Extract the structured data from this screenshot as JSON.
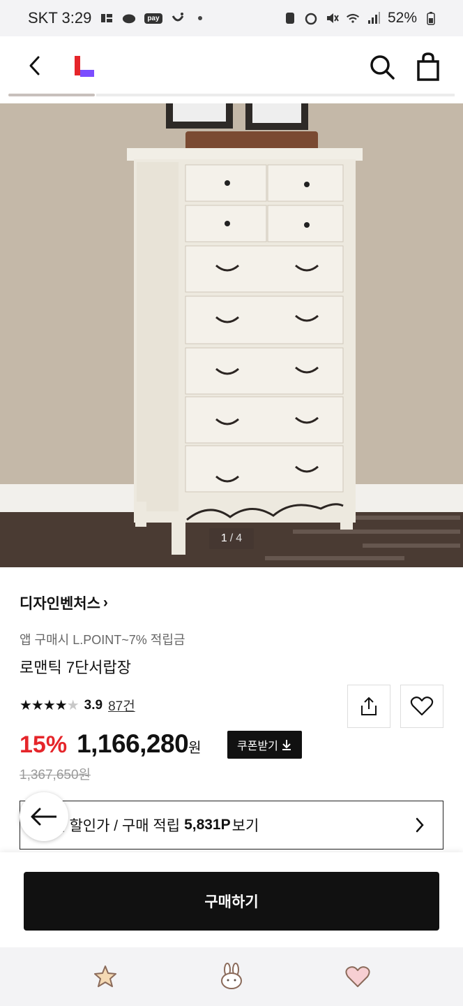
{
  "status_bar": {
    "carrier_time": "SKT 3:29",
    "pay_badge": "pay",
    "battery": "52%"
  },
  "header": {
    "icons": [
      "back-icon",
      "lotte-on-logo",
      "search-icon",
      "shopping-bag-icon"
    ]
  },
  "gallery": {
    "current": "1",
    "separator": "/",
    "total": "4"
  },
  "product": {
    "brand": "디자인벤처스",
    "brand_chevron": "›",
    "promo": "앱 구매시 L.POINT~7% 적립금",
    "title": "로맨틱 7단서랍장",
    "rating": {
      "stars_filled": "★★★★",
      "stars_empty": "★",
      "score": "3.9",
      "reviews": "87건"
    },
    "discount": "15%",
    "price": "1,166,280",
    "price_unit": "원",
    "coupon_label": "쿠폰받기",
    "original_price": "1,367,650원",
    "max_discount": {
      "prefix": "최대 할인가 / 구매 적립",
      "points": "5,831P",
      "suffix": "보기"
    }
  },
  "purchase": {
    "buy_label": "구매하기"
  },
  "colors": {
    "discount_red": "#e5252a",
    "primary_black": "#111111",
    "logo_red": "#e5252a",
    "logo_purple": "#7b4dff"
  }
}
